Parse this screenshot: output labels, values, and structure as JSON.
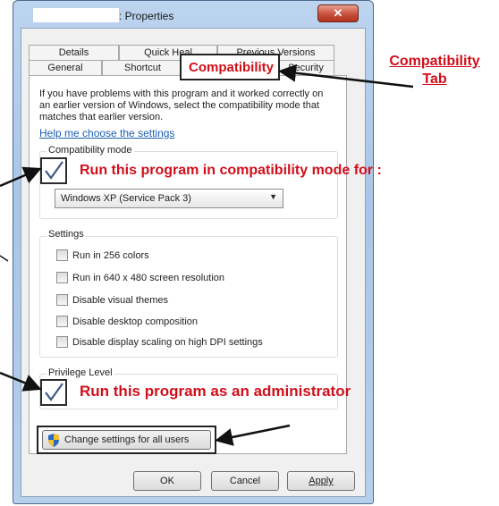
{
  "window": {
    "title": ": Properties",
    "close_glyph": "✕"
  },
  "tabs": {
    "row1": [
      "Details",
      "Quick Heal",
      "Previous Versions"
    ],
    "row2": [
      "General",
      "Shortcut",
      "Compatibility",
      "Security"
    ],
    "active": "Compatibility"
  },
  "panel": {
    "intro_lines": [
      "If you have problems with this program and it worked correctly on",
      "an earlier version of Windows, select the compatibility mode that",
      "matches that earlier version."
    ],
    "help_link": "Help me choose the settings",
    "compat_group_label": "Compatibility mode",
    "compat_checked": true,
    "compat_os_value": "Windows XP (Service Pack 3)",
    "settings_group_label": "Settings",
    "settings": [
      {
        "label": "Run in 256 colors",
        "checked": false
      },
      {
        "label": "Run in 640 x 480 screen resolution",
        "checked": false
      },
      {
        "label": "Disable visual themes",
        "checked": false
      },
      {
        "label": "Disable desktop composition",
        "checked": false
      },
      {
        "label": "Disable display scaling on high DPI settings",
        "checked": false
      }
    ],
    "privilege_group_label": "Privilege Level",
    "admin_checked": true,
    "change_all_users_label": "Change settings for all users"
  },
  "buttons": {
    "ok": "OK",
    "cancel": "Cancel",
    "apply": "Apply"
  },
  "annotations": {
    "compat_mode_text": "Run this program in compatibility mode for :",
    "admin_text": "Run this program as an administrator",
    "tab_callout_line1": "Compatibility",
    "tab_callout_line2": "Tab",
    "highlight_color": "#d10f1b"
  }
}
